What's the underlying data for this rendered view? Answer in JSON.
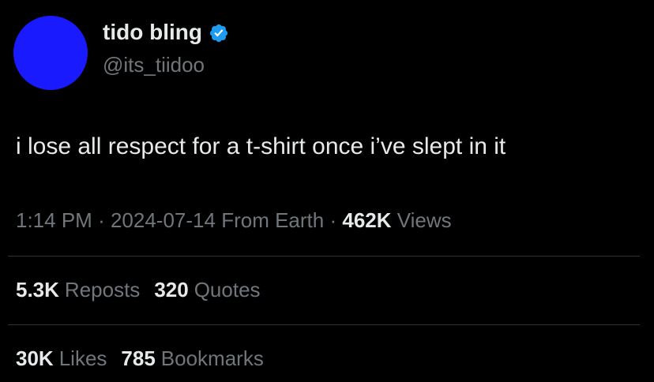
{
  "author": {
    "display_name": "tido bling",
    "handle": "@its_tiidoo",
    "avatar_color": "#1a1aff",
    "verified_color": "#1d9bf0",
    "verified_icon": "verified-badge-icon"
  },
  "tweet": {
    "text": "i lose all respect for a t-shirt once i’ve slept in it"
  },
  "meta": {
    "time": "1:14 PM",
    "sep1": "·",
    "date": "2024-07-14",
    "location": "From Earth",
    "sep2": "·",
    "views_count": "462K",
    "views_label": "Views"
  },
  "stats_row1": {
    "reposts_count": "5.3K",
    "reposts_label": "Reposts",
    "quotes_count": "320",
    "quotes_label": "Quotes"
  },
  "stats_row2": {
    "likes_count": "30K",
    "likes_label": "Likes",
    "bookmarks_count": "785",
    "bookmarks_label": "Bookmarks"
  }
}
